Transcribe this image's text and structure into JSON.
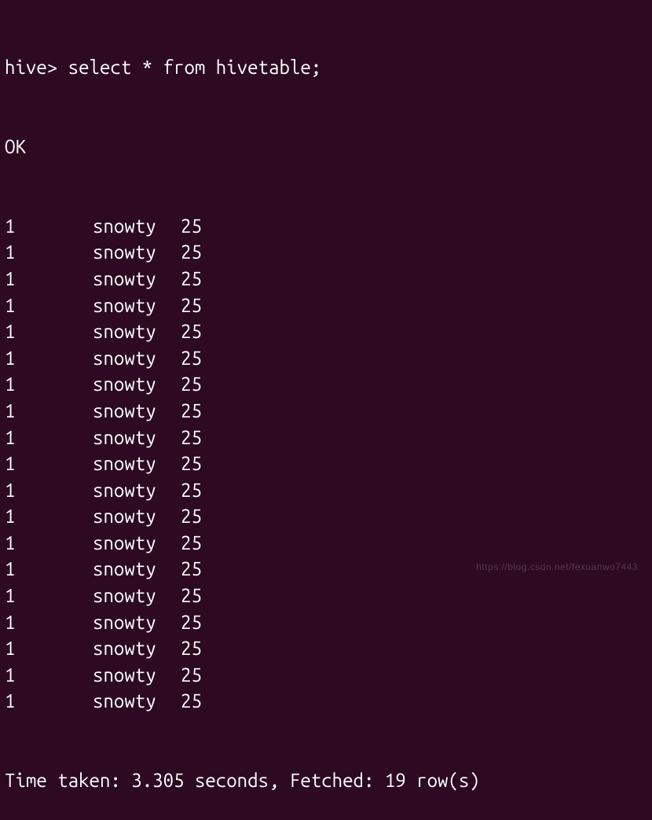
{
  "prompt": "hive> ",
  "command": "select * from hivetable;",
  "status": "OK",
  "rows": [
    {
      "c1": "1",
      "c2": "snowty",
      "c3": "25"
    },
    {
      "c1": "1",
      "c2": "snowty",
      "c3": "25"
    },
    {
      "c1": "1",
      "c2": "snowty",
      "c3": "25"
    },
    {
      "c1": "1",
      "c2": "snowty",
      "c3": "25"
    },
    {
      "c1": "1",
      "c2": "snowty",
      "c3": "25"
    },
    {
      "c1": "1",
      "c2": "snowty",
      "c3": "25"
    },
    {
      "c1": "1",
      "c2": "snowty",
      "c3": "25"
    },
    {
      "c1": "1",
      "c2": "snowty",
      "c3": "25"
    },
    {
      "c1": "1",
      "c2": "snowty",
      "c3": "25"
    },
    {
      "c1": "1",
      "c2": "snowty",
      "c3": "25"
    },
    {
      "c1": "1",
      "c2": "snowty",
      "c3": "25"
    },
    {
      "c1": "1",
      "c2": "snowty",
      "c3": "25"
    },
    {
      "c1": "1",
      "c2": "snowty",
      "c3": "25"
    },
    {
      "c1": "1",
      "c2": "snowty",
      "c3": "25"
    },
    {
      "c1": "1",
      "c2": "snowty",
      "c3": "25"
    },
    {
      "c1": "1",
      "c2": "snowty",
      "c3": "25"
    },
    {
      "c1": "1",
      "c2": "snowty",
      "c3": "25"
    },
    {
      "c1": "1",
      "c2": "snowty",
      "c3": "25"
    },
    {
      "c1": "1",
      "c2": "snowty",
      "c3": "25"
    }
  ],
  "footer": "Time taken: 3.305 seconds, Fetched: 19 row(s)",
  "watermark": "https://blog.csdn.net/fexuanwo7443"
}
